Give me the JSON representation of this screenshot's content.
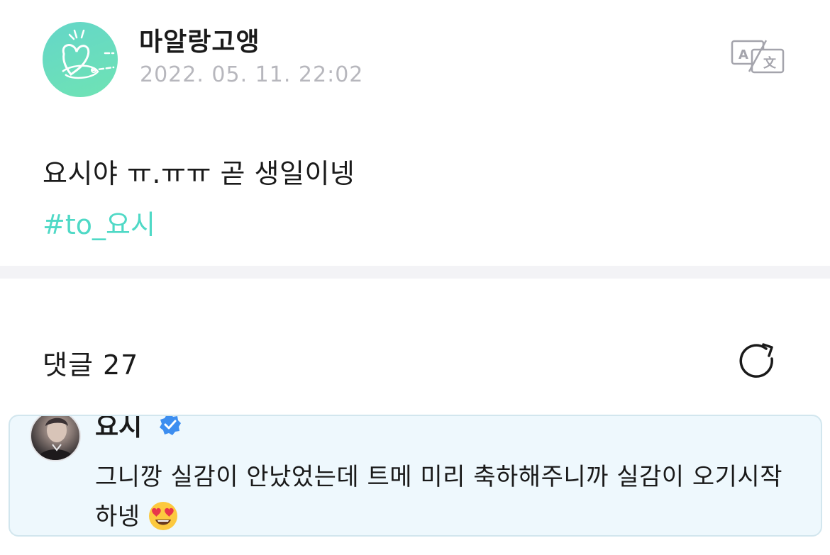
{
  "post": {
    "author": "마알랑고앵",
    "timestamp": "2022. 05. 11. 22:02",
    "text": "요시야 ㅠ.ㅠㅠ 곧 생일이넹",
    "hashtag": "#to_요시",
    "translate_icon": "translate-icon"
  },
  "comments": {
    "title": "댓글 27",
    "refresh_icon": "refresh-icon",
    "items": [
      {
        "author": "요시",
        "verified": true,
        "text": "그니깡 실감이 안났었는데 트메 미리 축하해주니까 실감이 오기시작하넹",
        "emoji": "heart-eyes-emoji"
      }
    ]
  },
  "colors": {
    "accent": "#4fd9c6",
    "timestamp": "#b7b7bd",
    "divider": "#f3f3f6",
    "card_bg": "#eef8fd",
    "badge": "#3d8ef0"
  }
}
